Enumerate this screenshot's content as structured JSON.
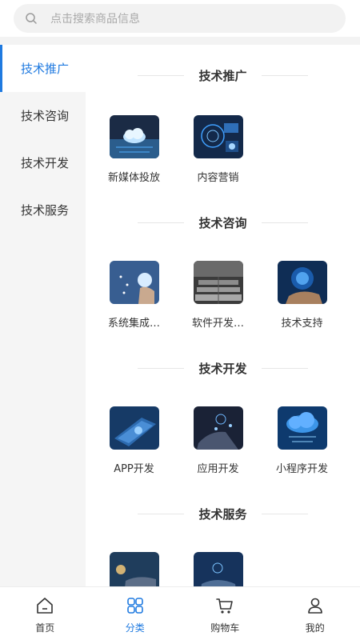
{
  "search": {
    "placeholder": "点击搜索商品信息"
  },
  "sidebar": {
    "items": [
      {
        "label": "技术推广",
        "active": true
      },
      {
        "label": "技术咨询",
        "active": false
      },
      {
        "label": "技术开发",
        "active": false
      },
      {
        "label": "技术服务",
        "active": false
      }
    ]
  },
  "sections": [
    {
      "title": "技术推广",
      "items": [
        {
          "label": "新媒体投放"
        },
        {
          "label": "内容营销"
        }
      ]
    },
    {
      "title": "技术咨询",
      "items": [
        {
          "label": "系统集成…"
        },
        {
          "label": "软件开发…"
        },
        {
          "label": "技术支持"
        }
      ]
    },
    {
      "title": "技术开发",
      "items": [
        {
          "label": "APP开发"
        },
        {
          "label": "应用开发"
        },
        {
          "label": "小程序开发"
        }
      ]
    },
    {
      "title": "技术服务",
      "items": [
        {
          "label": ""
        },
        {
          "label": ""
        }
      ]
    }
  ],
  "tabbar": {
    "items": [
      {
        "label": "首页",
        "icon": "home-icon"
      },
      {
        "label": "分类",
        "icon": "category-icon",
        "active": true
      },
      {
        "label": "购物车",
        "icon": "cart-icon"
      },
      {
        "label": "我的",
        "icon": "user-icon"
      }
    ]
  },
  "colors": {
    "accent": "#1f7ae0",
    "sidebar_bg": "#f5f5f5"
  }
}
